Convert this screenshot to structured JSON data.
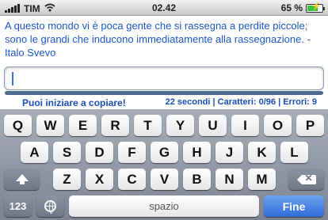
{
  "status_bar": {
    "carrier": "TIM",
    "time": "02.42",
    "battery": "65 %",
    "battery_level": 0.65,
    "icons": [
      "signal-icon",
      "wifi-icon",
      "battery-charging-icon"
    ]
  },
  "quote": {
    "text": "A questo mondo vi è poca gente che si rassegna a perdite piccole; sono le grandi che inducono immediatamente alla rassegnazione. - Italo Svevo"
  },
  "input": {
    "value": ""
  },
  "info": {
    "message": "Puoi iniziare a copiare!",
    "stats": "22 secondi | Caratteri: 0/96 | Errori: 9"
  },
  "keyboard": {
    "row1": [
      "Q",
      "W",
      "E",
      "R",
      "T",
      "Y",
      "U",
      "I",
      "O",
      "P"
    ],
    "row2": [
      "A",
      "S",
      "D",
      "F",
      "G",
      "H",
      "J",
      "K",
      "L"
    ],
    "row3": [
      "Z",
      "X",
      "C",
      "V",
      "B",
      "N",
      "M"
    ],
    "numbers_label": "123",
    "space_label": "spazio",
    "done_label": "Fine",
    "icons": [
      "shift-icon",
      "backspace-icon",
      "globe-icon"
    ]
  },
  "colors": {
    "accent_text": "#1b57c9",
    "done_key": "#2f6ad8"
  }
}
